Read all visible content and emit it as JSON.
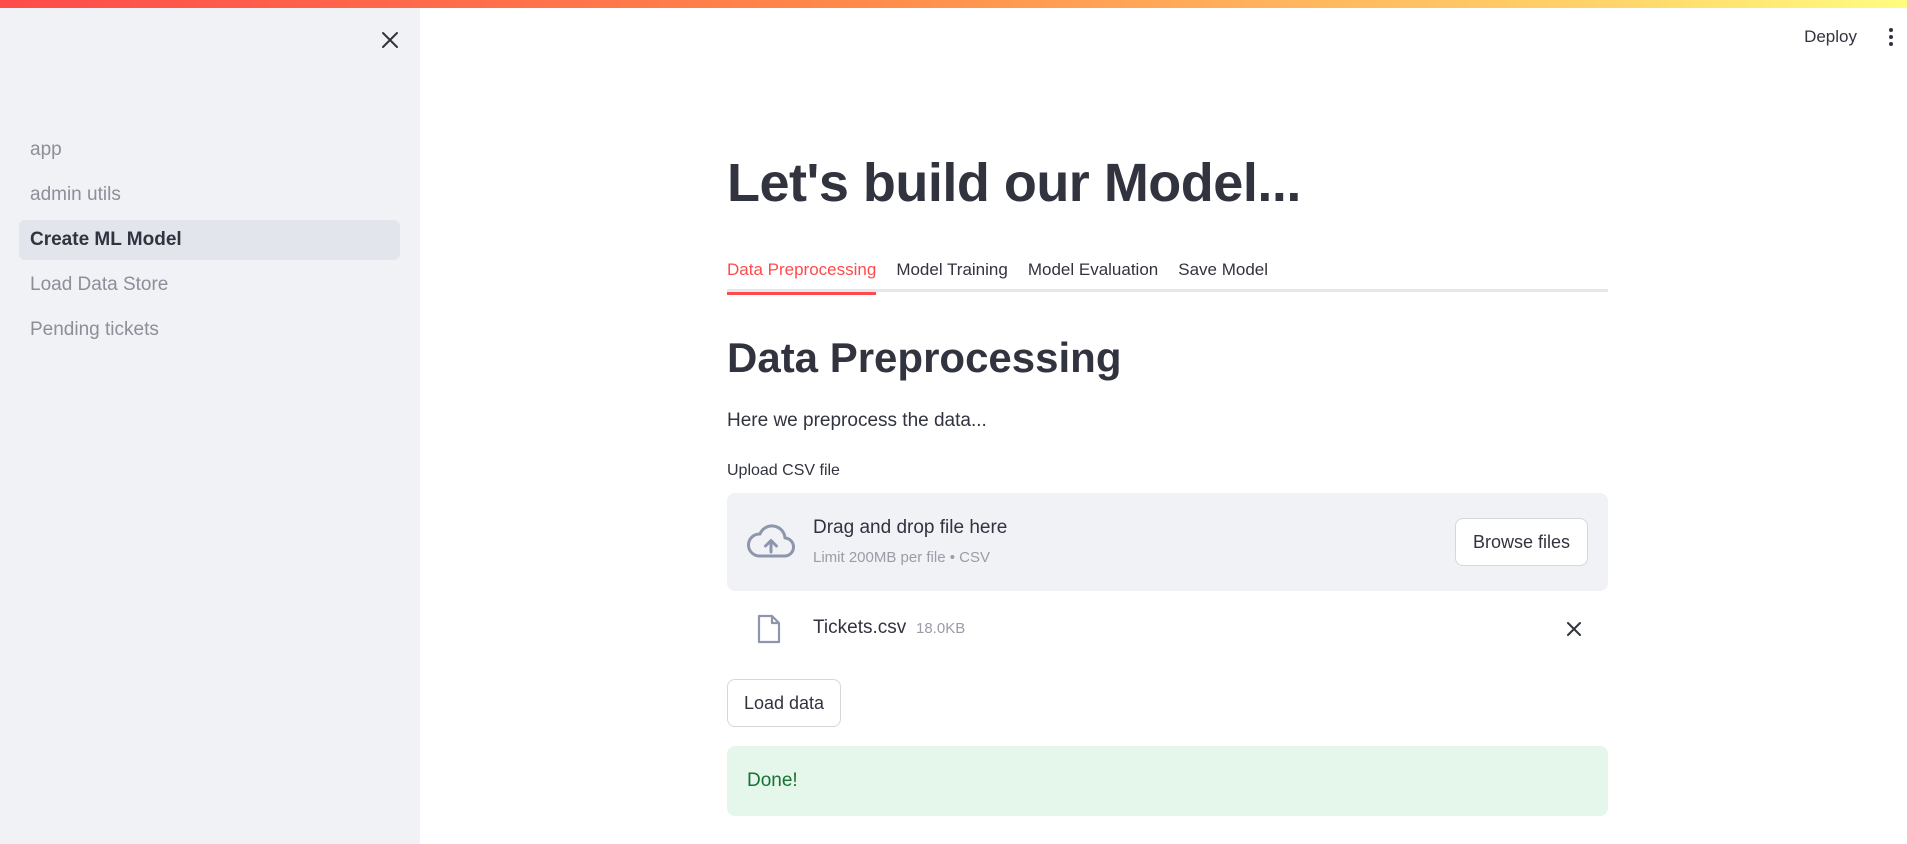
{
  "header": {
    "deploy_label": "Deploy",
    "menu_icon": "kebab-menu-icon"
  },
  "sidebar": {
    "close_icon": "close-icon",
    "items": [
      {
        "label": "app",
        "active": false
      },
      {
        "label": "admin utils",
        "active": false
      },
      {
        "label": "Create ML Model",
        "active": true
      },
      {
        "label": "Load Data Store",
        "active": false
      },
      {
        "label": "Pending tickets",
        "active": false
      }
    ]
  },
  "main": {
    "title": "Let's build our Model...",
    "tabs": [
      {
        "label": "Data Preprocessing",
        "active": true
      },
      {
        "label": "Model Training",
        "active": false
      },
      {
        "label": "Model Evaluation",
        "active": false
      },
      {
        "label": "Save Model",
        "active": false
      }
    ],
    "section_title": "Data Preprocessing",
    "section_desc": "Here we preprocess the data...",
    "uploader": {
      "label": "Upload CSV file",
      "drop_title": "Drag and drop file here",
      "drop_subtitle": "Limit 200MB per file • CSV",
      "browse_label": "Browse files",
      "icon": "cloud-upload-icon"
    },
    "uploaded_file": {
      "name": "Tickets.csv",
      "size": "18.0KB",
      "icon": "file-icon"
    },
    "load_button_label": "Load data",
    "success_message": "Done!"
  },
  "colors": {
    "accent": "#ff4b4b",
    "sidebar_bg": "#f0f2f6",
    "success_bg": "#e5f7ea",
    "success_text": "#177233"
  }
}
